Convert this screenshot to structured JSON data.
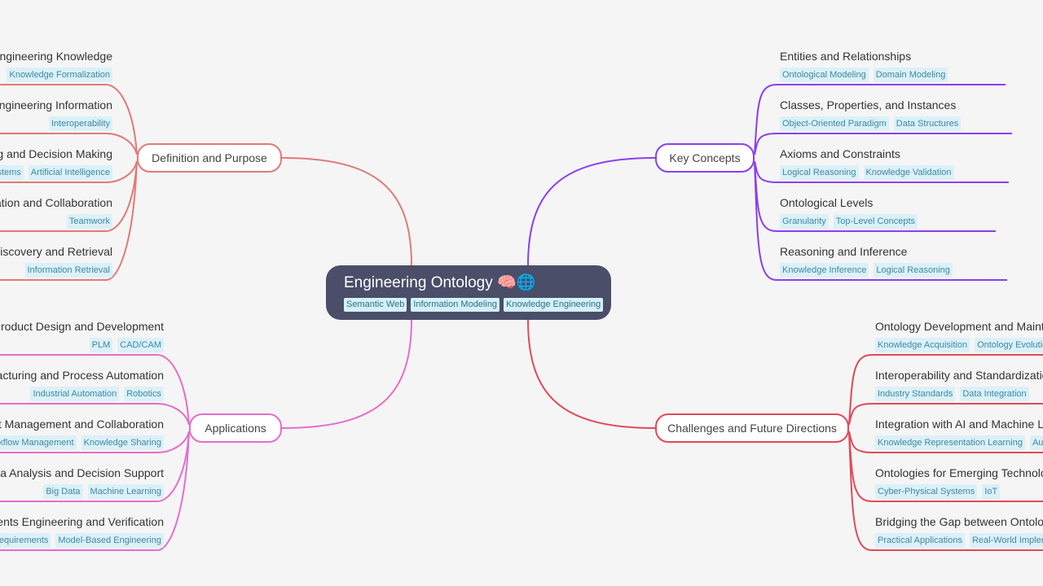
{
  "root": {
    "title": "Engineering Ontology 🧠🌐",
    "tags": [
      "Semantic Web",
      "Information Modeling",
      "Knowledge Engineering"
    ]
  },
  "colors": {
    "root_bg": "#4a4e69",
    "definition": "#e07a78",
    "key_concepts": "#8a3ff0",
    "applications": "#e46ecb",
    "challenges": "#e04a5a",
    "tag_bg": "#dcf0f8",
    "tag_text": "#3a8aa6"
  },
  "branches": {
    "definition": {
      "label": "Definition and Purpose",
      "items": [
        {
          "title": "Formalizing Engineering Knowledge",
          "tags": [
            "Knowledge Formalization"
          ]
        },
        {
          "title": "Structuring Engineering Information",
          "tags": [
            "Interoperability"
          ]
        },
        {
          "title": "Supporting Reasoning and Decision Making",
          "tags": [
            "Expert Systems",
            "Artificial Intelligence"
          ]
        },
        {
          "title": "Facilitating Communication and Collaboration",
          "tags": [
            "Teamwork"
          ]
        },
        {
          "title": "Enabling Knowledge Discovery and Retrieval",
          "tags": [
            "Information Retrieval"
          ]
        }
      ]
    },
    "key_concepts": {
      "label": "Key Concepts",
      "items": [
        {
          "title": "Entities and Relationships",
          "tags": [
            "Ontological Modeling",
            "Domain Modeling"
          ]
        },
        {
          "title": "Classes, Properties, and Instances",
          "tags": [
            "Object-Oriented Paradigm",
            "Data Structures"
          ]
        },
        {
          "title": "Axioms and Constraints",
          "tags": [
            "Logical Reasoning",
            "Knowledge Validation"
          ]
        },
        {
          "title": "Ontological Levels",
          "tags": [
            "Granularity",
            "Top-Level Concepts"
          ]
        },
        {
          "title": "Reasoning and Inference",
          "tags": [
            "Knowledge Inference",
            "Logical Reasoning"
          ]
        }
      ]
    },
    "applications": {
      "label": "Applications",
      "items": [
        {
          "title": "Product Design and Development",
          "tags": [
            "PLM",
            "CAD/CAM"
          ]
        },
        {
          "title": "Manufacturing and Process Automation",
          "tags": [
            "Industrial Automation",
            "Robotics"
          ]
        },
        {
          "title": "Project Management and Collaboration",
          "tags": [
            "Workflow Management",
            "Knowledge Sharing"
          ]
        },
        {
          "title": "Data Analysis and Decision Support",
          "tags": [
            "Big Data",
            "Machine Learning"
          ]
        },
        {
          "title": "Requirements Engineering and Verification",
          "tags": [
            "Requirements",
            "Model-Based Engineering"
          ]
        }
      ]
    },
    "challenges": {
      "label": "Challenges and Future Directions",
      "items": [
        {
          "title": "Ontology Development and Maintenance",
          "tags": [
            "Knowledge Acquisition",
            "Ontology Evolution"
          ]
        },
        {
          "title": "Interoperability and Standardization",
          "tags": [
            "Industry Standards",
            "Data Integration"
          ]
        },
        {
          "title": "Integration with AI and Machine Learning",
          "tags": [
            "Knowledge Representation Learning",
            "Automation"
          ]
        },
        {
          "title": "Ontologies for Emerging Technologies",
          "tags": [
            "Cyber-Physical Systems",
            "IoT"
          ]
        },
        {
          "title": "Bridging the Gap between Ontology and Practice",
          "tags": [
            "Practical Applications",
            "Real-World Implementation"
          ]
        }
      ]
    }
  }
}
